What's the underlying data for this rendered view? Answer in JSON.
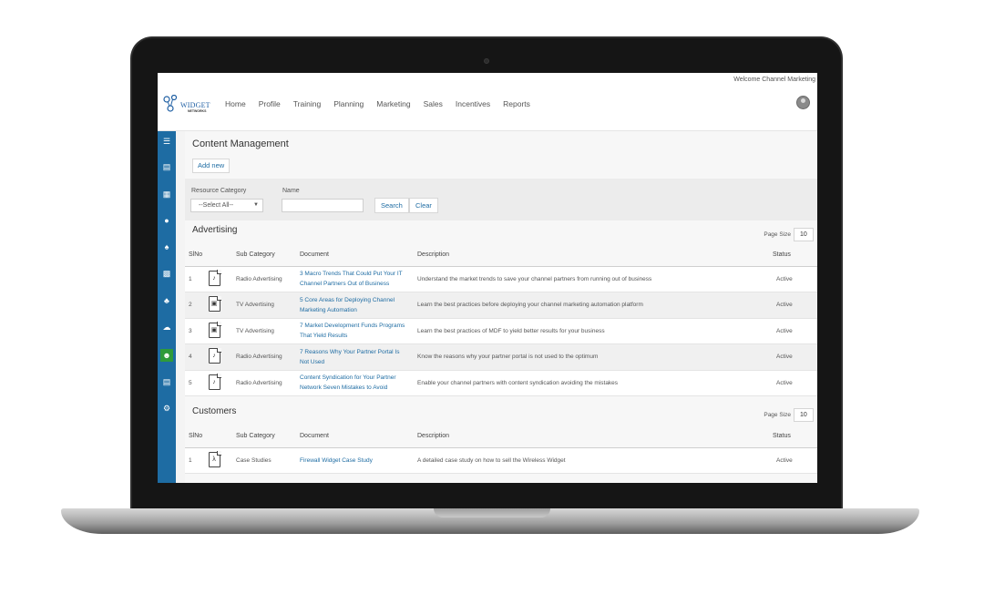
{
  "header": {
    "welcome_text": "Welcome Channel Marketing",
    "logo_text": "WIDGET",
    "logo_sub": "NETWORKS",
    "nav": [
      "Home",
      "Profile",
      "Training",
      "Planning",
      "Marketing",
      "Sales",
      "Incentives",
      "Reports"
    ]
  },
  "sidebar": {
    "icons": [
      "menu-icon",
      "dashboard-icon",
      "calendar-icon",
      "funds-icon",
      "partners-icon",
      "deals-icon",
      "org-chart-icon",
      "network-icon",
      "user-icon",
      "reports-icon",
      "settings-icon"
    ],
    "active_index": 8,
    "accent_color": "#1e6ca3",
    "active_color": "#2e9a3a"
  },
  "page": {
    "title": "Content Management",
    "add_new_label": "Add new"
  },
  "filters": {
    "category_label": "Resource Category",
    "category_value": "--Select All--",
    "name_label": "Name",
    "name_value": "",
    "search_label": "Search",
    "clear_label": "Clear"
  },
  "sections": [
    {
      "title": "Advertising",
      "page_size_label": "Page Size",
      "page_size_value": "10",
      "columns": [
        "SlNo",
        "Sub Category",
        "Document",
        "Description",
        "Status"
      ],
      "rows": [
        {
          "no": "1",
          "icon": "audio-file-icon",
          "sub": "Radio Advertising",
          "doc": "3 Macro Trends That Could Put Your IT Channel Partners Out of Business",
          "desc": "Understand the market trends to save your channel partners from running out of business",
          "status": "Active"
        },
        {
          "no": "2",
          "icon": "video-file-icon",
          "sub": "TV Advertising",
          "doc": "5 Core Areas for Deploying Channel Marketing Automation",
          "desc": "Learn the best practices before deploying your channel marketing automation platform",
          "status": "Active"
        },
        {
          "no": "3",
          "icon": "video-file-icon",
          "sub": "TV Advertising",
          "doc": "7 Market Development Funds Programs That Yield Results",
          "desc": "Learn the best practices of MDF to yield better results for your business",
          "status": "Active"
        },
        {
          "no": "4",
          "icon": "audio-file-icon",
          "sub": "Radio Advertising",
          "doc": "7 Reasons Why Your Partner Portal Is Not Used",
          "desc": "Know the reasons why your partner portal is not used to the optimum",
          "status": "Active"
        },
        {
          "no": "5",
          "icon": "audio-file-icon",
          "sub": "Radio Advertising",
          "doc": "Content Syndication for Your Partner Network Seven Mistakes to Avoid",
          "desc": "Enable your channel partners with content syndication avoiding the mistakes",
          "status": "Active"
        }
      ]
    },
    {
      "title": "Customers",
      "page_size_label": "Page Size",
      "page_size_value": "10",
      "columns": [
        "SlNo",
        "Sub Category",
        "Document",
        "Description",
        "Status"
      ],
      "rows": [
        {
          "no": "1",
          "icon": "pdf-file-icon",
          "sub": "Case Studies",
          "doc": "Firewall Widget Case Study",
          "desc": "A detailed case study on how to sell the Wireless Widget",
          "status": "Active"
        }
      ]
    }
  ]
}
